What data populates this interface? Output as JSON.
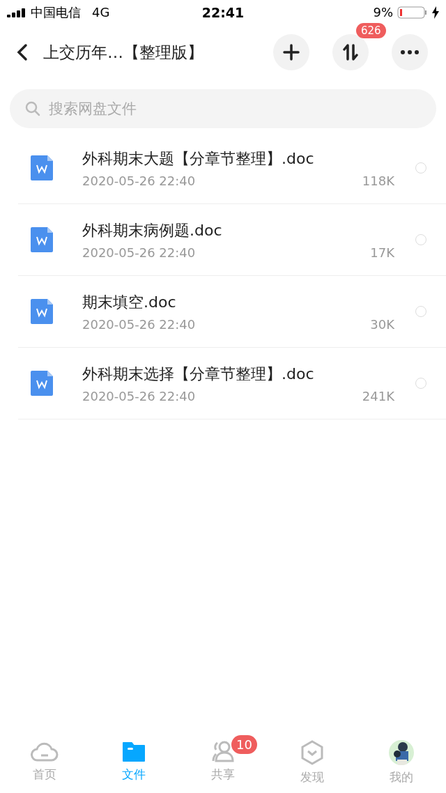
{
  "status_bar": {
    "carrier": "中国电信",
    "network": "4G",
    "time": "22:41",
    "battery": "9%"
  },
  "header": {
    "title": "上交历年…【整理版】",
    "transfer_badge": "626"
  },
  "search": {
    "placeholder": "搜索网盘文件"
  },
  "files": [
    {
      "name": "外科期末大题【分章节整理】.doc",
      "date": "2020-05-26 22:40",
      "size": "118K",
      "selected": false
    },
    {
      "name": "外科期末病例题.doc",
      "date": "2020-05-26 22:40",
      "size": "17K",
      "selected": false
    },
    {
      "name": "期末填空.doc",
      "date": "2020-05-26 22:40",
      "size": "30K",
      "selected": false
    },
    {
      "name": "外科期末选择【分章节整理】.doc",
      "date": "2020-05-26 22:40",
      "size": "241K",
      "selected": false
    }
  ],
  "tab_bar": [
    {
      "kind": "home",
      "label": "首页",
      "selected": false
    },
    {
      "kind": "files",
      "label": "文件",
      "selected": true
    },
    {
      "kind": "share",
      "label": "共享",
      "selected": false,
      "badge": "10"
    },
    {
      "kind": "discover",
      "label": "发现",
      "selected": false
    },
    {
      "kind": "me",
      "label": "我的",
      "selected": false
    }
  ]
}
